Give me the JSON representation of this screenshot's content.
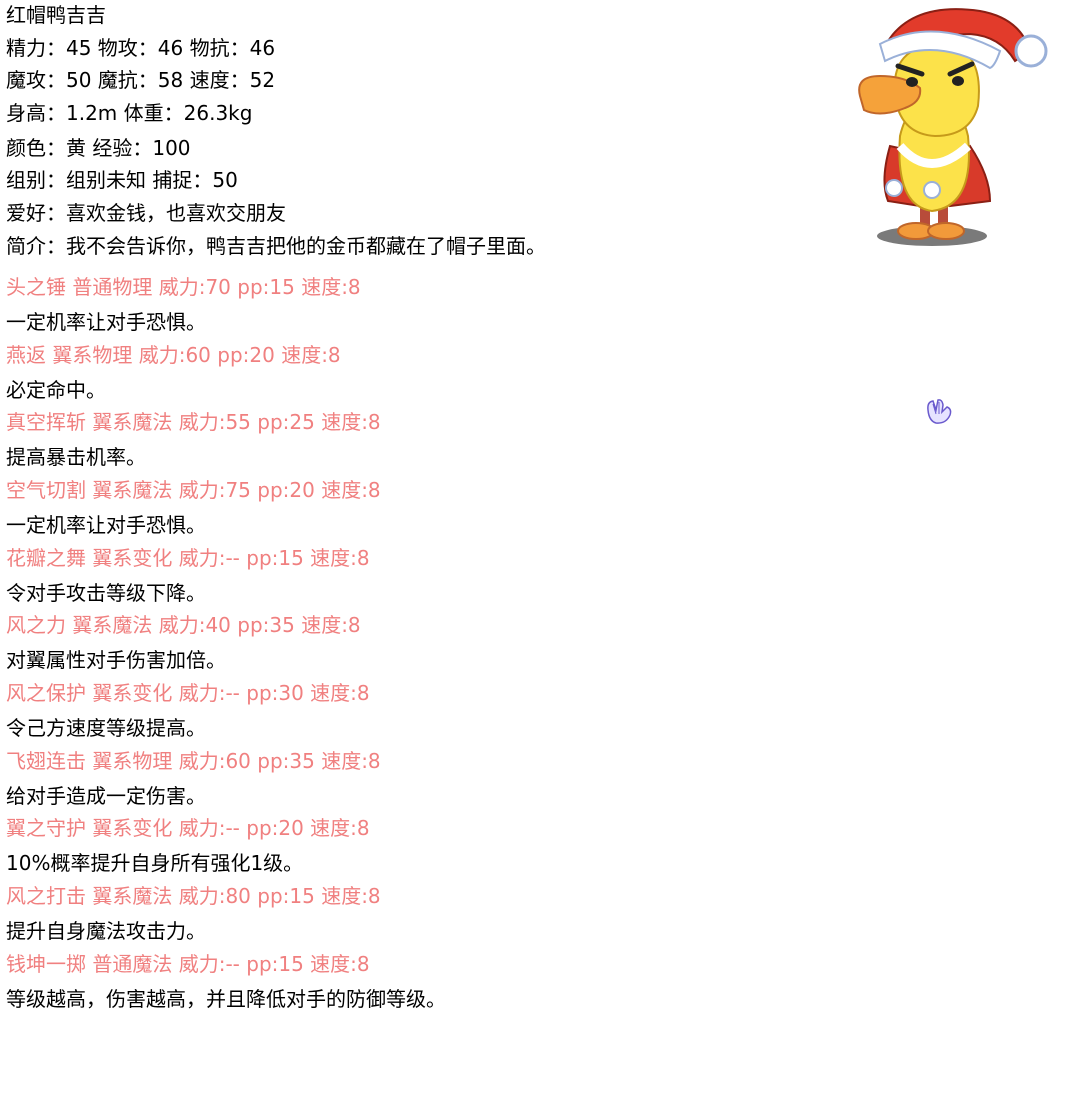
{
  "pet": {
    "name": "红帽鸭吉吉",
    "line_stats1": "精力：45 物攻：46 物抗：46",
    "line_stats2": "魔攻：50 魔抗：58 速度：52",
    "line_body": "身高：1.2m 体重：26.3kg",
    "line_color": "颜色：黄 经验：100",
    "line_group": "组别：组别未知 捕捉：50",
    "line_hobby": "爱好：喜欢金钱，也喜欢交朋友",
    "line_intro": "简介：我不会告诉你，鸭吉吉把他的金币都藏在了帽子里面。"
  },
  "skills": [
    {
      "head": "头之锤 普通物理 威力:70 pp:15 速度:8",
      "desc": "一定机率让对手恐惧。"
    },
    {
      "head": "燕返 翼系物理 威力:60 pp:20 速度:8",
      "desc": "必定命中。"
    },
    {
      "head": "真空挥斩 翼系魔法 威力:55 pp:25 速度:8",
      "desc": "提高暴击机率。"
    },
    {
      "head": "空气切割 翼系魔法 威力:75 pp:20 速度:8",
      "desc": "一定机率让对手恐惧。"
    },
    {
      "head": "花瓣之舞 翼系变化 威力:-- pp:15 速度:8",
      "desc": "令对手攻击等级下降。"
    },
    {
      "head": "风之力 翼系魔法 威力:40 pp:35 速度:8",
      "desc": "对翼属性对手伤害加倍。"
    },
    {
      "head": "风之保护 翼系变化 威力:-- pp:30 速度:8",
      "desc": "令己方速度等级提高。"
    },
    {
      "head": "飞翅连击 翼系物理 威力:60 pp:35 速度:8",
      "desc": "给对手造成一定伤害。"
    },
    {
      "head": "翼之守护 翼系变化 威力:-- pp:20 速度:8",
      "desc": "10%概率提升自身所有强化1级。"
    },
    {
      "head": "风之打击 翼系魔法 威力:80 pp:15 速度:8",
      "desc": "提升自身魔法攻击力。"
    },
    {
      "head": "钱坤一掷 普通魔法 威力:-- pp:15 速度:8",
      "desc": "等级越高，伤害越高，并且降低对手的防御等级。"
    }
  ],
  "colors": {
    "skill_head": "#f08080",
    "text": "#000000",
    "background": "#ffffff"
  },
  "icons": {
    "mascot": "duck-santa-hat-mascot-image",
    "cursor": "hand-cursor-icon"
  }
}
